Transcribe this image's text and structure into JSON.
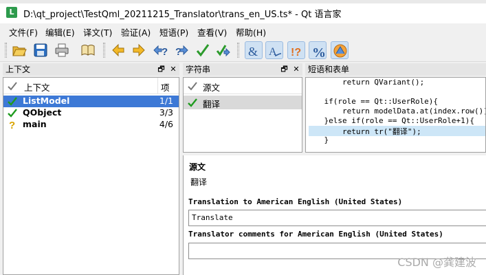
{
  "window": {
    "title": "D:\\qt_project\\TestQml_20211215_Translator\\trans_en_US.ts* - Qt 语言家",
    "app_icon": "L"
  },
  "menubar": [
    "文件(F)",
    "编辑(E)",
    "译文(T)",
    "验证(A)",
    "短语(P)",
    "查看(V)",
    "帮助(H)"
  ],
  "toolbar": {
    "icons": [
      "open-icon",
      "save-icon",
      "print-icon",
      "book-icon",
      "prev-icon",
      "next-icon",
      "prev-unfinished-icon",
      "next-unfinished-icon",
      "done-icon",
      "done-next-icon",
      "accelerator-icon",
      "surrounding-whitespace-icon",
      "ending-punctuation-icon",
      "place-marker-icon",
      "phrase-match-icon"
    ]
  },
  "context_dock": {
    "title": "上下文",
    "header_label": "上下文",
    "header_count": "项",
    "rows": [
      {
        "name": "ListModel",
        "count": "1/1",
        "status": "done",
        "selected": true
      },
      {
        "name": "QObject",
        "count": "3/3",
        "status": "done",
        "selected": false
      },
      {
        "name": "main",
        "count": "4/6",
        "status": "unfinished",
        "selected": false
      }
    ]
  },
  "strings_dock": {
    "title": "字符串",
    "header_label": "源文",
    "rows": [
      {
        "text": "翻译",
        "status": "done",
        "selected": true
      }
    ]
  },
  "phrases_dock": {
    "title": "短语和表单",
    "code_lines": [
      "        return QVariant();",
      "",
      "    if(role == Qt::UserRole){",
      "        return modelData.at(index.row());",
      "    }else if(role == Qt::UserRole+1){",
      "        return tr(\"翻译\");",
      "    }"
    ],
    "highlighted_line": 5
  },
  "editor": {
    "source_label": "源文",
    "source_text": "翻译",
    "translation_label": "Translation to American English (United States)",
    "translation_value": "Translate",
    "comments_label": "Translator comments for American English (United States)",
    "comments_value": ""
  },
  "dock_buttons": {
    "float": "🗗",
    "close": "✕"
  },
  "watermark": "CSDN @龚建波"
}
